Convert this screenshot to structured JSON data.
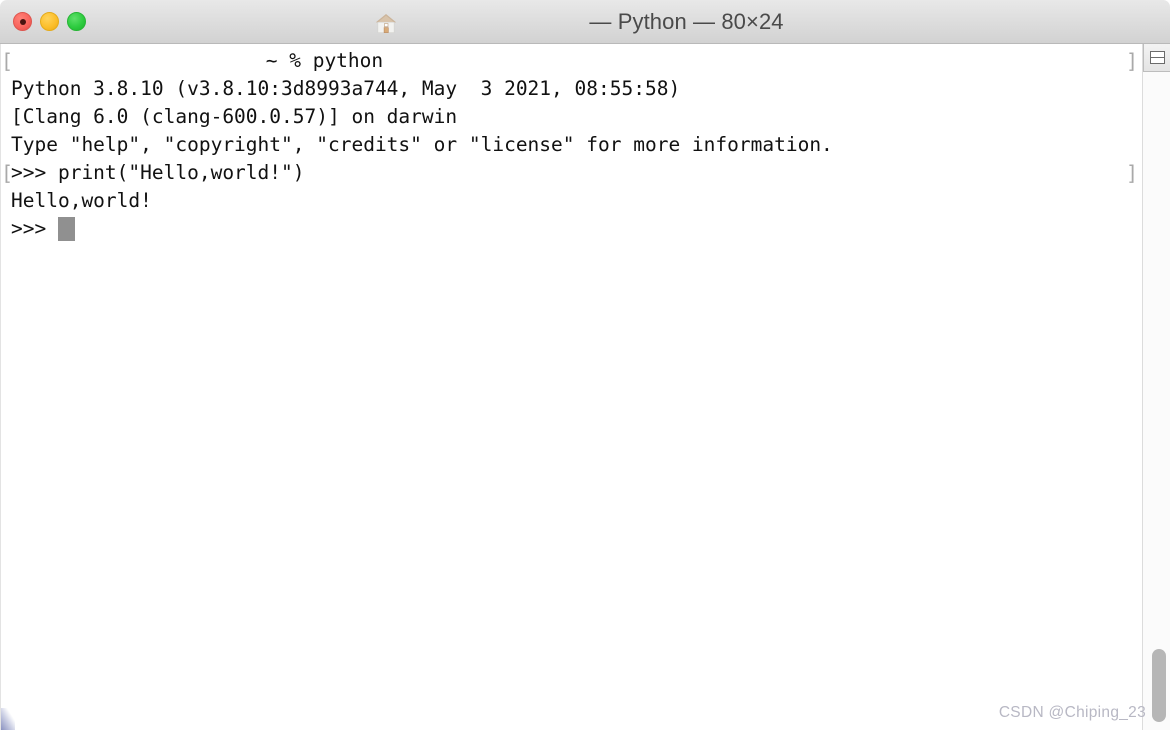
{
  "window": {
    "title_app": "Python",
    "title_size": "80×24",
    "title_full": "— Python — 80×24",
    "title_icon": "home-icon",
    "title_redacted_label": "",
    "controls": {
      "close_label": "close",
      "minimize_label": "minimize",
      "zoom_label": "zoom"
    }
  },
  "terminal": {
    "lines": [
      {
        "id": "shell-prompt-line",
        "mark_left": "[",
        "mark_right": "]",
        "has_blur": true,
        "text": " ~ % python"
      },
      {
        "id": "python-version-line",
        "mark_left": "",
        "mark_right": "",
        "has_blur": false,
        "text": "Python 3.8.10 (v3.8.10:3d8993a744, May  3 2021, 08:55:58)"
      },
      {
        "id": "clang-line",
        "mark_left": "",
        "mark_right": "",
        "has_blur": false,
        "text": "[Clang 6.0 (clang-600.0.57)] on darwin"
      },
      {
        "id": "help-hint-line",
        "mark_left": "",
        "mark_right": "",
        "has_blur": false,
        "text": "Type \"help\", \"copyright\", \"credits\" or \"license\" for more information."
      },
      {
        "id": "print-command-line",
        "mark_left": "[",
        "mark_right": "]",
        "has_blur": false,
        "text": ">>> print(\"Hello,world!\")"
      },
      {
        "id": "output-line",
        "mark_left": "",
        "mark_right": "",
        "has_blur": false,
        "text": "Hello,world!"
      }
    ],
    "final_prompt": ">>> ",
    "cursor": "block",
    "colors": {
      "background": "#ffffff",
      "foreground": "#111111",
      "cursor": "#909090",
      "prompt_mark": "#a9a9a9"
    }
  },
  "sidebar_controls": {
    "split_pane_label": "split-pane",
    "scrollbar_label": "vertical-scrollbar"
  },
  "watermark": {
    "text": "CSDN @Chiping_23"
  }
}
